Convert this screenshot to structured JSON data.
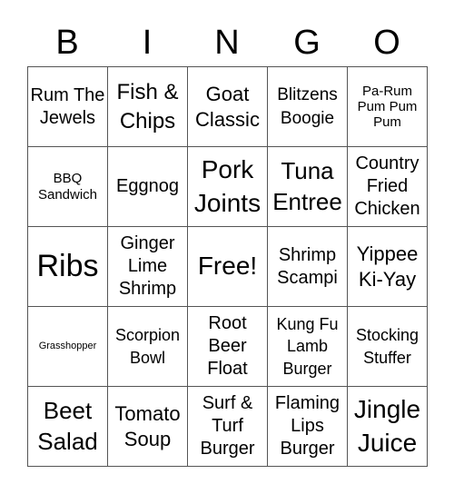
{
  "header": {
    "letters": [
      "B",
      "I",
      "N",
      "G",
      "O"
    ]
  },
  "cells": [
    "Rum The Jewels",
    "Fish & Chips",
    "Goat Classic",
    "Blitzens Boogie",
    "Pa-Rum Pum Pum Pum",
    "BBQ Sandwich",
    "Eggnog",
    "Pork Joints",
    "Tuna Entree",
    "Country Fried Chicken",
    "Ribs",
    "Ginger Lime Shrimp",
    "Free!",
    "Shrimp Scampi",
    "Yippee Ki-Yay",
    "Grasshopper",
    "Scorpion Bowl",
    "Root Beer Float",
    "Kung Fu Lamb Burger",
    "Stocking Stuffer",
    "Beet Salad",
    "Tomato Soup",
    "Surf & Turf Burger",
    "Flaming Lips Burger",
    "Jingle Juice"
  ]
}
